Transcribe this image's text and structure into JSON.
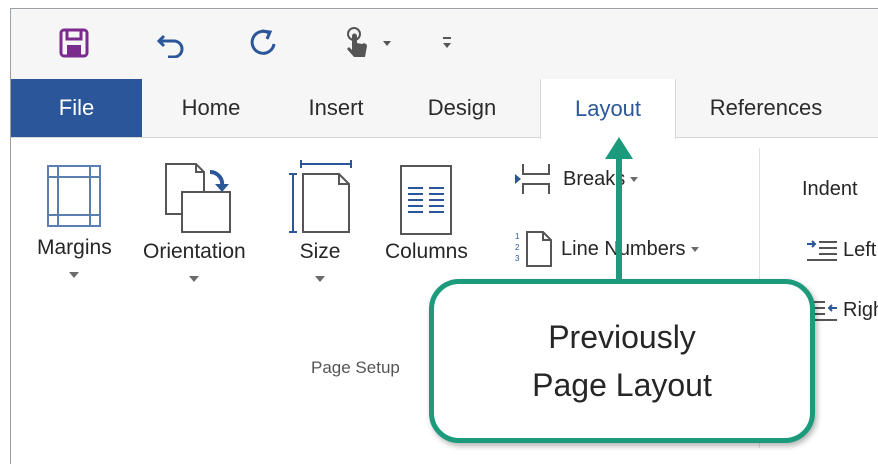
{
  "quick_access": {
    "save_icon": "save-icon",
    "undo_icon": "undo-icon",
    "redo_icon": "redo-icon",
    "touch_mode_icon": "touch-mode-icon",
    "customize_icon": "customize-toolbar-icon"
  },
  "tabs": {
    "file": "File",
    "home": "Home",
    "insert": "Insert",
    "design": "Design",
    "layout": "Layout",
    "references": "References"
  },
  "page_setup": {
    "margins": "Margins",
    "orientation": "Orientation",
    "size": "Size",
    "columns": "Columns",
    "breaks": "Breaks",
    "line_numbers": "Line Numbers",
    "group_label": "Page Setup"
  },
  "paragraph": {
    "indent": "Indent",
    "left": "Left",
    "right": "Right"
  },
  "callout": {
    "line1": "Previously",
    "line2": "Page Layout"
  },
  "colors": {
    "file_tab": "#2b579a",
    "accent": "#2b579a",
    "callout_border": "#1b9b7c",
    "save_icon": "#7b2a8e"
  }
}
